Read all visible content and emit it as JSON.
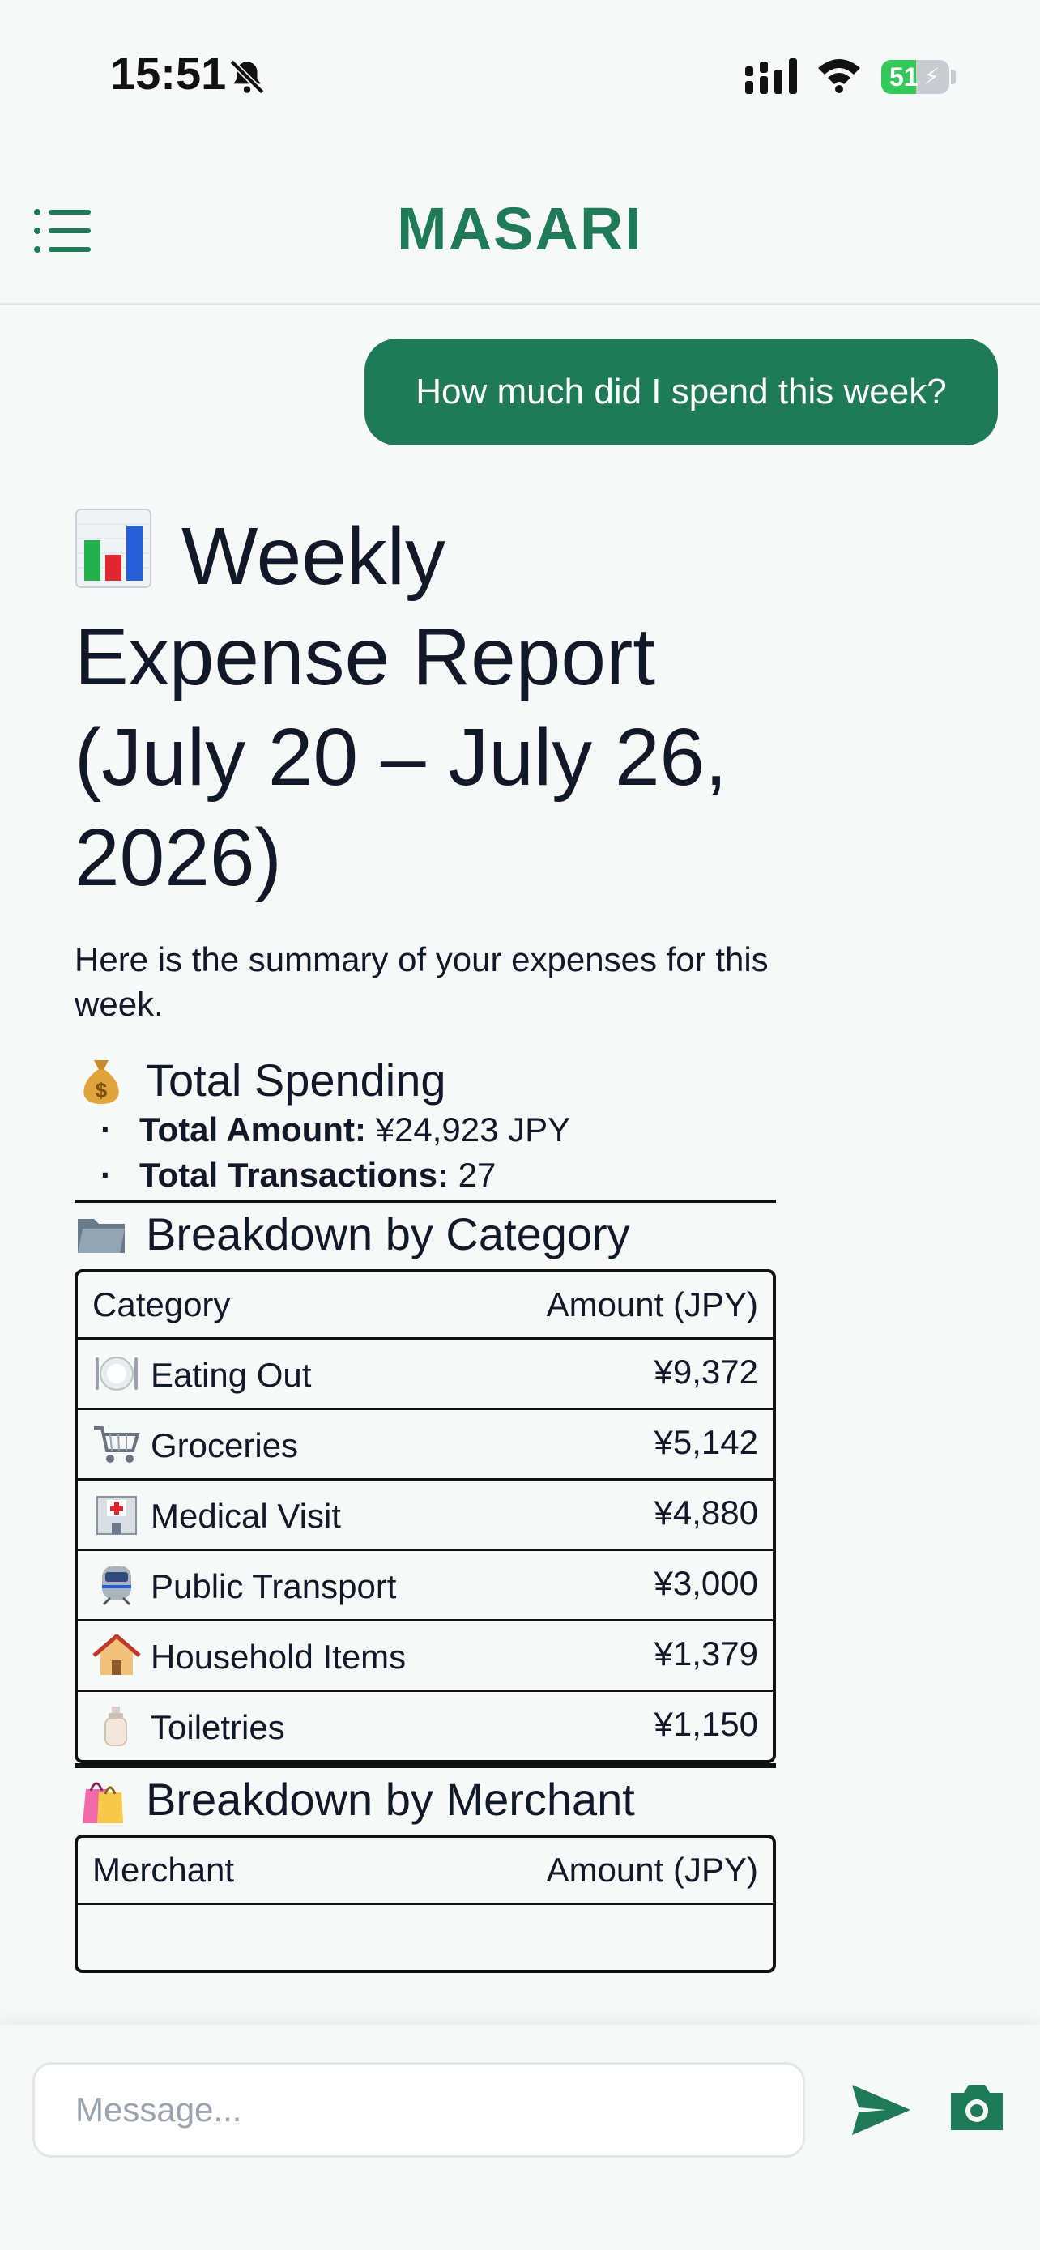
{
  "status_bar": {
    "time": "15:51",
    "battery": "51",
    "battery_level": 0.51,
    "icons": [
      "bell-slash-icon",
      "signal-icon",
      "wifi-icon",
      "battery-charging-icon"
    ]
  },
  "header": {
    "title": "MASARI",
    "menu_icon": "menu-list-icon",
    "accent_color": "#1f7a57"
  },
  "chat": {
    "user_message": "How much did I spend this week?"
  },
  "report": {
    "title": "Weekly Expense Report (July 20 – July 26, 2026)",
    "title_icon": "bar-chart-emoji",
    "summary": "Here is the summary of your expenses for this week.",
    "total_section": {
      "heading": "Total Spending",
      "icon": "money-bag-emoji",
      "items": [
        {
          "label": "Total Amount:",
          "value": "¥24,923 JPY"
        },
        {
          "label": "Total Transactions:",
          "value": "27"
        }
      ]
    },
    "category_section": {
      "heading": "Breakdown by Category",
      "icon": "folder-emoji",
      "columns": [
        "Category",
        "Amount (JPY)"
      ],
      "rows": [
        {
          "icon": "plate-cutlery-emoji",
          "label": "Eating Out",
          "amount": "¥9,372"
        },
        {
          "icon": "shopping-cart-emoji",
          "label": "Groceries",
          "amount": "¥5,142"
        },
        {
          "icon": "hospital-emoji",
          "label": "Medical Visit",
          "amount": "¥4,880"
        },
        {
          "icon": "train-emoji",
          "label": "Public Transport",
          "amount": "¥3,000"
        },
        {
          "icon": "house-emoji",
          "label": "Household Items",
          "amount": "¥1,379"
        },
        {
          "icon": "lotion-bottle-emoji",
          "label": "Toiletries",
          "amount": "¥1,150"
        }
      ]
    },
    "merchant_section": {
      "heading": "Breakdown by Merchant",
      "icon": "shopping-bags-emoji",
      "columns": [
        "Merchant",
        "Amount (JPY)"
      ]
    }
  },
  "composer": {
    "placeholder": "Message...",
    "send_icon": "send-icon",
    "camera_icon": "camera-icon"
  }
}
